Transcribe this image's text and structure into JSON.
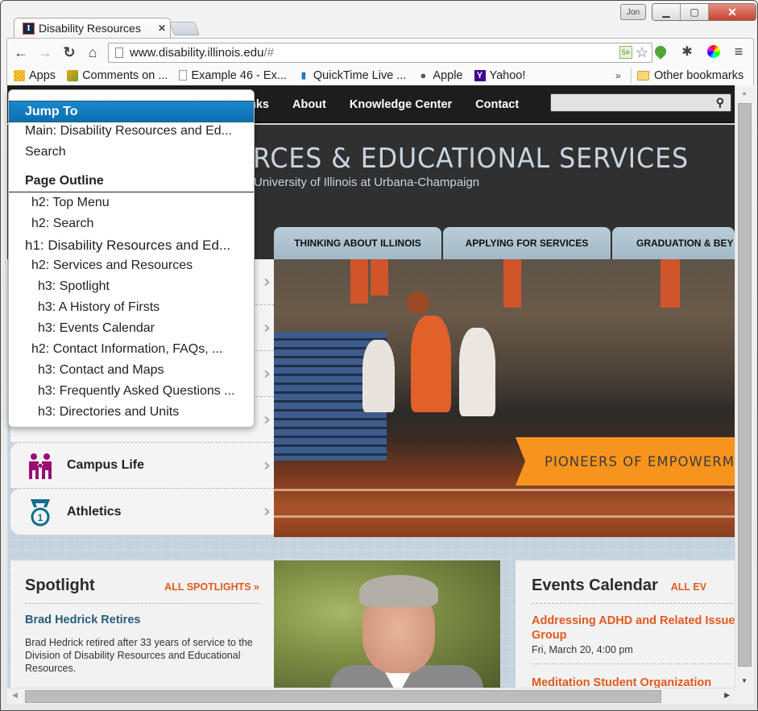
{
  "browser": {
    "tab_title": "Disability Resources",
    "tab_favicon_letter": "I",
    "user_name": "Jon",
    "url_host": "www.disability.illinois.edu",
    "url_path": "/#",
    "nav": {
      "back": "←",
      "forward": "→",
      "reload": "↻",
      "home": "⌂"
    },
    "window_buttons": {
      "minimize": "▁",
      "maximize": "▢",
      "close": "✕"
    },
    "bookmarks": [
      {
        "label": "Apps",
        "icon": "apps-icon"
      },
      {
        "label": "Comments on ...",
        "icon": "comments-icon"
      },
      {
        "label": "Example 46 - Ex...",
        "icon": "page-icon"
      },
      {
        "label": "QuickTime Live ...",
        "icon": "quicktime-icon"
      },
      {
        "label": "Apple",
        "icon": "apple-icon"
      },
      {
        "label": "Yahoo!",
        "icon": "yahoo-icon"
      }
    ],
    "bookmarks_overflow": "»",
    "other_bookmarks": "Other bookmarks"
  },
  "site": {
    "top_links": [
      "nks",
      "About",
      "Knowledge Center",
      "Contact"
    ],
    "search_value": "",
    "title": "RCES & EDUCATIONAL SERVICES",
    "subtitle": "University of Illinois at Urbana-Champaign",
    "feature_tabs": [
      "THINKING ABOUT ILLINOIS",
      "APPLYING FOR SERVICES",
      "GRADUATION & BEY"
    ],
    "hero_caption": "PIONEERS OF EMPOWERM",
    "categories": [
      {
        "label": "",
        "icon": "category-icon"
      },
      {
        "label": "",
        "icon": "category-icon"
      },
      {
        "label": "",
        "icon": "category-icon"
      },
      {
        "label": "",
        "icon": "purple-icon"
      },
      {
        "label": "Campus Life",
        "icon": "people-icon"
      },
      {
        "label": "Athletics",
        "icon": "medal-icon"
      }
    ],
    "spotlight": {
      "title": "Spotlight",
      "link": "ALL SPOTLIGHTS »",
      "headline": "Brad Hedrick Retires",
      "body": "Brad Hedrick retired after 33 years of service to the Division of Disability Resources and Educational Resources."
    },
    "events": {
      "title": "Events Calendar",
      "link": "ALL EV",
      "items": [
        {
          "title_line1": "Addressing ADHD and Related Issues",
          "title_line2": "Group",
          "date": "Fri, March 20, 4:00 pm"
        },
        {
          "title_line1": "Meditation Student Organization",
          "date": ""
        }
      ]
    }
  },
  "jump_menu": {
    "header": "Jump To",
    "landmarks": [
      "Main: Disability Resources and Ed...",
      "Search"
    ],
    "outline_header": "Page Outline",
    "outline": [
      {
        "level": 2,
        "text": "h2: Top Menu"
      },
      {
        "level": 2,
        "text": "h2: Search"
      },
      {
        "level": 1,
        "text": "h1: Disability Resources and Ed..."
      },
      {
        "level": 2,
        "text": "h2: Services and Resources"
      },
      {
        "level": 3,
        "text": "h3: Spotlight"
      },
      {
        "level": 3,
        "text": "h3: A History of Firsts"
      },
      {
        "level": 3,
        "text": "h3: Events Calendar"
      },
      {
        "level": 2,
        "text": "h2: Contact Information, FAQs, ..."
      },
      {
        "level": 3,
        "text": "h3: Contact and Maps"
      },
      {
        "level": 3,
        "text": "h3: Frequently Asked Questions ..."
      },
      {
        "level": 3,
        "text": "h3: Directories and Units"
      }
    ]
  },
  "colors": {
    "accent_orange": "#e05a1f",
    "illinois_blue": "#13294b",
    "ribbon_orange": "#f7941e",
    "menu_highlight": "#0b6fb0"
  }
}
